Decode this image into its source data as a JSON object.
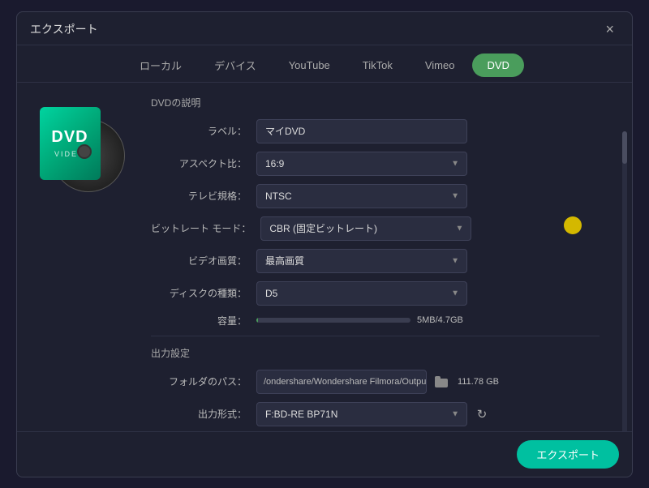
{
  "dialog": {
    "title": "エクスポート",
    "close_label": "×"
  },
  "tabs": [
    {
      "id": "local",
      "label": "ローカル",
      "active": false
    },
    {
      "id": "device",
      "label": "デバイス",
      "active": false
    },
    {
      "id": "youtube",
      "label": "YouTube",
      "active": false
    },
    {
      "id": "tiktok",
      "label": "TikTok",
      "active": false
    },
    {
      "id": "vimeo",
      "label": "Vimeo",
      "active": false
    },
    {
      "id": "dvd",
      "label": "DVD",
      "active": true
    }
  ],
  "dvd": {
    "section_title": "DVDの説明",
    "label_field": "ラベル：",
    "label_value": "マイDVD",
    "aspect_label": "アスペクト比：",
    "aspect_value": "16:9",
    "tv_label": "テレビ規格：",
    "tv_value": "NTSC",
    "bitrate_label": "ビットレート モード：",
    "bitrate_value": "CBR (固定ビットレート)",
    "video_label": "ビデオ画質：",
    "video_value": "最高画質",
    "disc_label": "ディスクの種類：",
    "disc_value": "D5",
    "capacity_label": "容量：",
    "capacity_text": "5MB/4.7GB",
    "capacity_percent": 1,
    "output_section": "出力設定",
    "folder_label": "フォルダのパス：",
    "folder_path": "/ondershare/Wondershare Filmora/Output",
    "folder_size": "111.78 GB",
    "output_label": "出力形式：",
    "output_value": "F:BD-RE BP71N",
    "export_label": "エクスポート"
  },
  "dvd_icon": {
    "main_text": "DVD",
    "sub_text": "VIDEO"
  }
}
